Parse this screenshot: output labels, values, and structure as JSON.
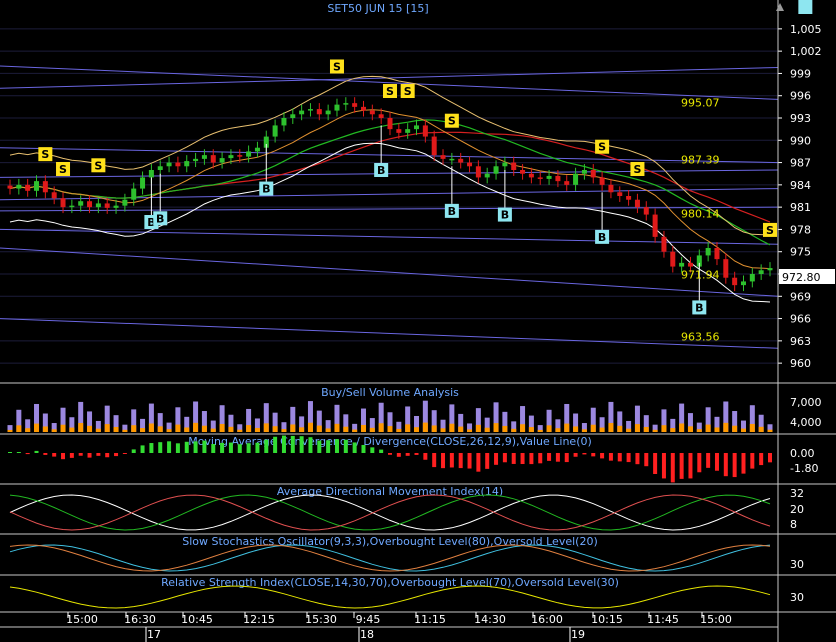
{
  "title": "SET50 JUN 15   [15]",
  "last_price": "972.80",
  "colors": {
    "background": "#000000",
    "text_axis": "#ffffff",
    "title": "#6fa8ff",
    "panel_title": "#6fa8ff",
    "grid": "#1c1c3a",
    "separator": "#c8c8c8",
    "trend_lines": "#6a66e0",
    "up_candle": "#2ec12e",
    "down_candle": "#e01a1a",
    "sell_marker": "#ffe11a",
    "buy_marker": "#8ee6f0",
    "label_yellow": "#e6e600",
    "volume_purple": "#9c88e0",
    "volume_orange": "#ff9900"
  },
  "chart_data": [
    {
      "type": "candlestick",
      "title": "SET50 JUN 15   [15]",
      "ylim": [
        958,
        1007
      ],
      "y_ticks": [
        "1,005",
        "1,002",
        "999",
        "996",
        "993",
        "990",
        "987",
        "984",
        "981",
        "978",
        "975",
        "972",
        "969",
        "966",
        "963",
        "960"
      ],
      "y_tick_values": [
        1005,
        1002,
        999,
        996,
        993,
        990,
        987,
        984,
        981,
        978,
        975,
        972,
        969,
        966,
        963,
        960
      ],
      "current_price": 972.8,
      "close_series": [
        983.5,
        984.0,
        983.2,
        984.5,
        983.0,
        982.2,
        981.0,
        981.2,
        981.8,
        981.0,
        981.5,
        980.9,
        981.2,
        982.0,
        983.5,
        985.0,
        986.0,
        986.5,
        987.0,
        986.5,
        987.2,
        987.5,
        988.0,
        987.0,
        987.6,
        988.0,
        987.8,
        988.5,
        989.0,
        990.5,
        992.0,
        993.0,
        993.5,
        994.0,
        994.2,
        993.5,
        994.0,
        994.8,
        995.0,
        994.5,
        994.0,
        993.5,
        993.0,
        991.5,
        991.0,
        991.5,
        992.0,
        990.5,
        988.0,
        987.5,
        987.5,
        987.0,
        986.5,
        985.0,
        985.5,
        986.5,
        987.0,
        986.0,
        985.5,
        985.0,
        984.8,
        985.2,
        984.5,
        984.0,
        985.5,
        986.0,
        985.0,
        984.0,
        983.0,
        982.5,
        982.0,
        981.0,
        980.0,
        977.0,
        975.0,
        973.0,
        973.5,
        973.0,
        974.5,
        975.5,
        974.0,
        971.5,
        970.5,
        971.0,
        972.0,
        972.5,
        972.8
      ],
      "annotations": [
        {
          "label": "995.07",
          "value": 995.07
        },
        {
          "label": "987.39",
          "value": 987.39
        },
        {
          "label": "980.14",
          "value": 980.14
        },
        {
          "label": "971.94",
          "value": 971.94
        },
        {
          "label": "963.56",
          "value": 963.56
        }
      ],
      "sell_signals": [
        4,
        6,
        10,
        37,
        43,
        45,
        50,
        67,
        71,
        86
      ],
      "buy_signals": [
        16,
        17,
        29,
        42,
        50,
        56,
        67,
        78,
        90
      ],
      "trend_lines": [
        {
          "left": 1000.0,
          "right": 995.5
        },
        {
          "left": 997.0,
          "right": 999.8
        },
        {
          "left": 989.0,
          "right": 987.0
        },
        {
          "left": 985.0,
          "right": 986.0
        },
        {
          "left": 982.0,
          "right": 983.5
        },
        {
          "left": 980.5,
          "right": 981.0
        },
        {
          "left": 978.0,
          "right": 976.0
        },
        {
          "left": 975.5,
          "right": 969.0
        },
        {
          "left": 966.0,
          "right": 962.0
        }
      ]
    },
    {
      "type": "bar",
      "title": "Buy/Sell Volume Analysis",
      "y_ticks": [
        "7,000",
        "4,000"
      ],
      "y_tick_values": [
        7000,
        4000
      ],
      "ylim": [
        0,
        10000
      ]
    },
    {
      "type": "line",
      "title": "Moving Average Convergence / Divergence(CLOSE,26,12,9),Value Line(0)",
      "y_ticks": [
        "0.00",
        "-1.80"
      ],
      "y_tick_values": [
        0.0,
        -1.8
      ]
    },
    {
      "type": "line",
      "title": "Average Directional Movement Index(14)",
      "y_ticks": [
        "32",
        "20",
        "8"
      ],
      "y_tick_values": [
        32,
        20,
        8
      ]
    },
    {
      "type": "line",
      "title": "Slow Stochastics Oscillator(9,3,3),Overbought Level(80),Oversold Level(20)",
      "y_ticks": [
        "30"
      ],
      "y_tick_values": [
        30
      ]
    },
    {
      "type": "line",
      "title": "Relative Strength Index(CLOSE,14,30,70),Overbought Level(70),Oversold Level(30)",
      "y_ticks": [
        "30"
      ],
      "y_tick_values": [
        30
      ]
    }
  ],
  "x_axis": {
    "times": [
      "15:00",
      "16:30",
      "10:45",
      "12:15",
      "15:30",
      "9:45",
      "11:15",
      "14:30",
      "16:00",
      "10:15",
      "11:45",
      "15:00"
    ],
    "days": [
      "17",
      "18",
      "19"
    ]
  }
}
